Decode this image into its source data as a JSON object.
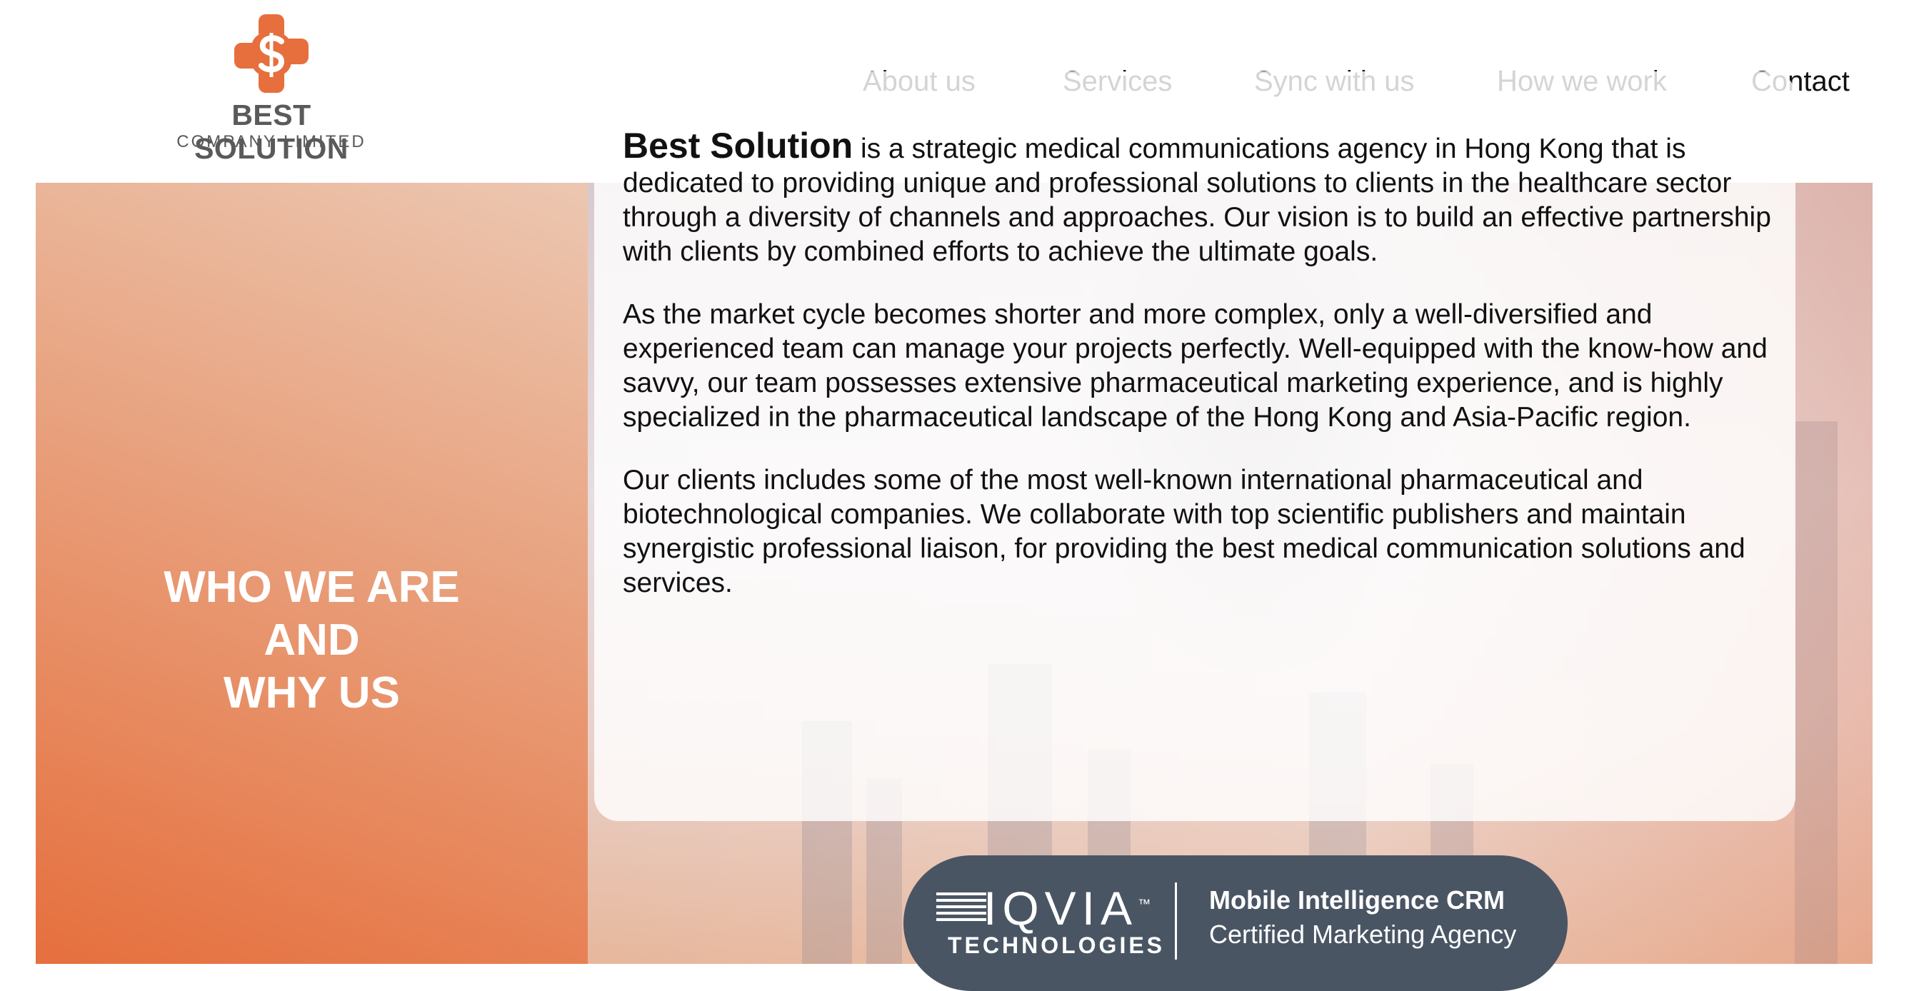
{
  "header": {
    "logo_name": "BEST SOLUTION",
    "logo_subtitle": "COMPANY LIMITED",
    "nav": [
      "About us",
      "Services",
      "Sync with us",
      "How we work",
      "Contact"
    ]
  },
  "hero": {
    "title_lines": [
      "WHO WE ARE",
      "AND",
      "WHY US"
    ]
  },
  "card": {
    "brand_lead": "Best Solution",
    "para1_rest": " is a strategic medical communications agency in Hong Kong that is dedicated to providing unique and professional solutions to clients in the healthcare sector through a diversity of channels and approaches. Our vision is to build an effective partnership with clients by combined efforts to achieve the ultimate goals.",
    "para2": "As the market cycle becomes shorter and more complex, only a well-diversified and experienced team can manage your projects perfectly. Well-equipped with the know-how and savvy, our team possesses extensive pharmaceutical marketing experience, and is highly specialized in the pharmaceutical landscape of the Hong Kong and Asia-Pacific region.",
    "para3": "Our clients includes some of the most well-known international pharmaceutical and biotechnological companies. We collaborate with top scientific publishers and maintain synergistic professional liaison, for providing the best medical communication solutions and services."
  },
  "badge": {
    "brand": "IQVIA",
    "trademark": "™",
    "sub": "TECHNOLOGIES",
    "line1": "Mobile Intelligence CRM",
    "line2": "Certified Marketing Agency"
  },
  "colors": {
    "accent_orange": "#e66f3d",
    "badge_bg": "#4a5564",
    "logo_grey": "#5a5a5a"
  }
}
